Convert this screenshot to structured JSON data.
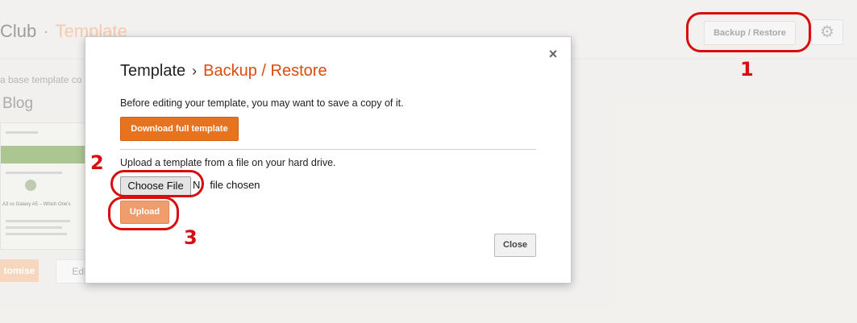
{
  "background": {
    "title_partial": "Club",
    "title_sep": "·",
    "title_crumb": "Template",
    "backup_button": "Backup / Restore",
    "gear_icon": "gear-icon",
    "description_partial": "a base template co",
    "blog_label": "Blog",
    "thumb_headline": "A3 vs Galaxy A5 – Which One's",
    "customise_button": "tomise",
    "edit_button": "Edit"
  },
  "dialog": {
    "title": "Template",
    "title_arrow": "›",
    "title_active": "Backup / Restore",
    "close_icon": "×",
    "intro_text": "Before editing your template, you may want to save a copy of it.",
    "download_button": "Download full template",
    "upload_text": "Upload a template from a file on your hard drive.",
    "choose_file_button": "Choose File",
    "file_status_first": "N",
    "file_status_rest": "file chosen",
    "upload_button": "Upload",
    "close_button": "Close"
  },
  "annotations": {
    "one": "1",
    "two": "2",
    "three": "3",
    "color": "#d80d0d"
  },
  "colors": {
    "accent": "#e8731f",
    "accent_light": "#ef9d6d",
    "title_active": "#dd4b0f"
  }
}
